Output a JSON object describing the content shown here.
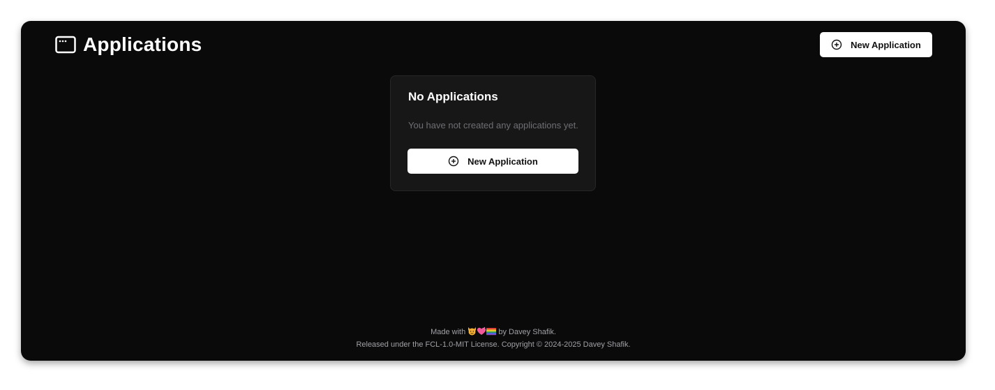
{
  "header": {
    "title": "Applications",
    "icon": "app-window-icon",
    "new_button_label": "New Application"
  },
  "empty_state": {
    "title": "No Applications",
    "message": "You have not created any applications yet.",
    "button_label": "New Application",
    "button_icon": "plus-circle-icon"
  },
  "footer": {
    "made_with_prefix": "Made with",
    "made_with_suffix": "by Davey Shafik.",
    "emoji": [
      "cat-face-emoji",
      "heart-emoji",
      "rainbow-flag-emoji"
    ],
    "license": "Released under the FCL-1.0-MIT License. Copyright © 2024-2025 Davey Shafik."
  },
  "colors": {
    "background": "#0a0a0b",
    "card": "#171718",
    "button": "#ffffff",
    "muted_text": "#6f6f74"
  }
}
